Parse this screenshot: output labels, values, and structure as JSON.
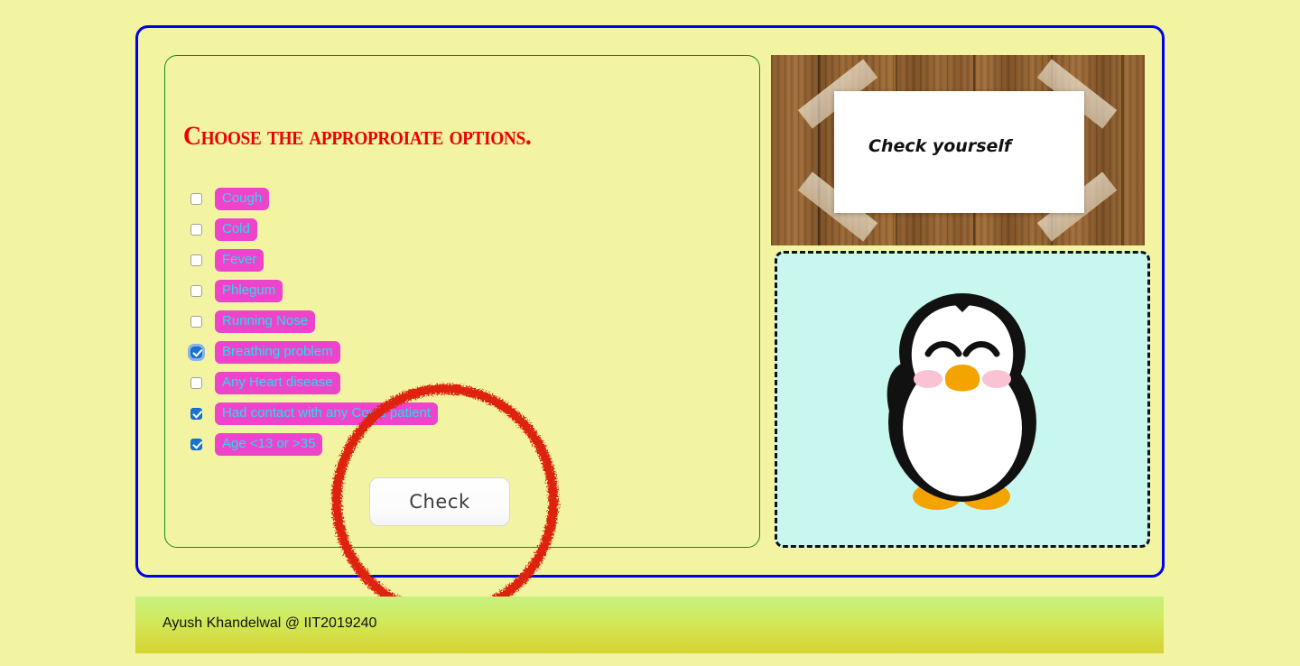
{
  "page": {
    "background_color": "#f2f4a2",
    "outer_border_color": "#0000ee",
    "inner_border_color": "#1a8a1a"
  },
  "form": {
    "title": "Choose the approproiate options.",
    "title_color": "#ee0000",
    "label_bg_color": "#ee44cc",
    "label_text_color": "#22ddee",
    "options": [
      {
        "label": "Cough",
        "checked": false,
        "focused": false
      },
      {
        "label": "Cold",
        "checked": false,
        "focused": false
      },
      {
        "label": "Fever",
        "checked": false,
        "focused": false
      },
      {
        "label": "Phlegum",
        "checked": false,
        "focused": false
      },
      {
        "label": "Running Nose",
        "checked": false,
        "focused": false
      },
      {
        "label": "Breathing problem",
        "checked": true,
        "focused": true
      },
      {
        "label": "Any Heart disease",
        "checked": false,
        "focused": false
      },
      {
        "label": "Had contact with any Covid patient",
        "checked": true,
        "focused": false
      },
      {
        "label": "Age <13 or >35",
        "checked": true,
        "focused": false
      }
    ],
    "submit_label": "Check"
  },
  "annotation": {
    "shape": "red-circle-highlight",
    "color": "#dd2211",
    "target": "Check"
  },
  "sign": {
    "text": "Check yourself",
    "paper_color": "#ffffff",
    "wood_color": "#8b5a2b"
  },
  "mascot": {
    "name": "penguin-illustration",
    "background_color": "#c7f7ef",
    "border_style": "dashed",
    "border_color": "#111111",
    "body_color": "#111111",
    "belly_color": "#ffffff",
    "beak_color": "#f5a300",
    "cheek_color": "#f9c3d4"
  },
  "footer": {
    "text": "Ayush Khandelwal @ IIT2019240",
    "gradient_from": "#c7f17f",
    "gradient_to": "#d6d331"
  }
}
